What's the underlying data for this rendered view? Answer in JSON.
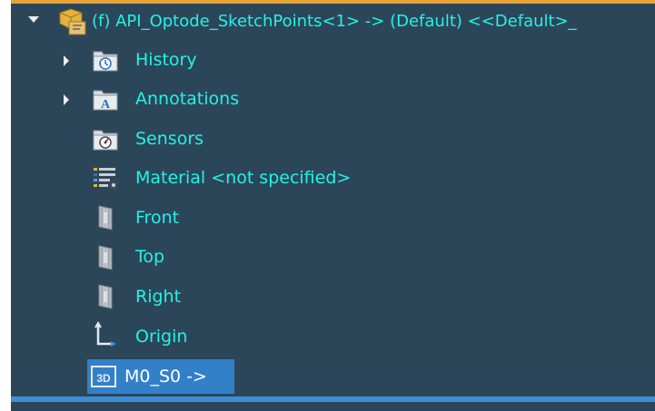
{
  "root": {
    "label": "(f) API_Optode_SketchPoints<1> -> (Default) <<Default>_",
    "icon": "part-icon",
    "expanded": true
  },
  "items": [
    {
      "label": "History",
      "icon": "history-folder-icon",
      "expandable": true
    },
    {
      "label": "Annotations",
      "icon": "annotations-folder-icon",
      "expandable": true
    },
    {
      "label": "Sensors",
      "icon": "sensors-folder-icon",
      "expandable": false
    },
    {
      "label": "Material <not specified>",
      "icon": "material-icon",
      "expandable": false
    },
    {
      "label": "Front",
      "icon": "plane-icon",
      "expandable": false
    },
    {
      "label": "Top",
      "icon": "plane-icon",
      "expandable": false
    },
    {
      "label": "Right",
      "icon": "plane-icon",
      "expandable": false
    },
    {
      "label": "Origin",
      "icon": "origin-icon",
      "expandable": false
    },
    {
      "label": "M0_S0 ->",
      "icon": "3d-sketch-icon",
      "expandable": false,
      "selected": true
    }
  ],
  "colors": {
    "panel_bg": "#2c4659",
    "text": "#22f2e8",
    "selection_bg": "#3281c8",
    "accent_top": "#e8a23a",
    "bottom_bar": "#3d8ed8"
  }
}
